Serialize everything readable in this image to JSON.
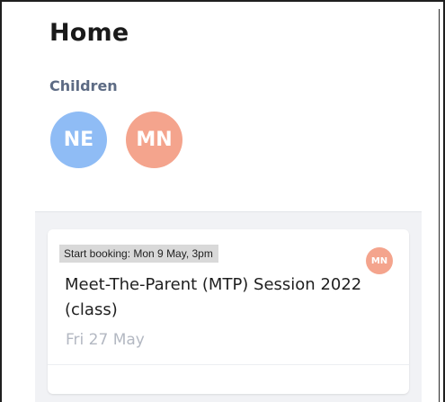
{
  "header": {
    "title": "Home"
  },
  "children": {
    "label": "Children",
    "items": [
      {
        "initials": "NE",
        "color": "#8fbcf5"
      },
      {
        "initials": "MN",
        "color": "#f4a48d"
      }
    ]
  },
  "events": [
    {
      "booking_tag": "Start booking: Mon 9 May, 3pm",
      "child_initials": "MN",
      "child_color": "#f4a48d",
      "title": "Meet-The-Parent (MTP) Session 2022 (class)",
      "date": "Fri 27 May"
    }
  ]
}
